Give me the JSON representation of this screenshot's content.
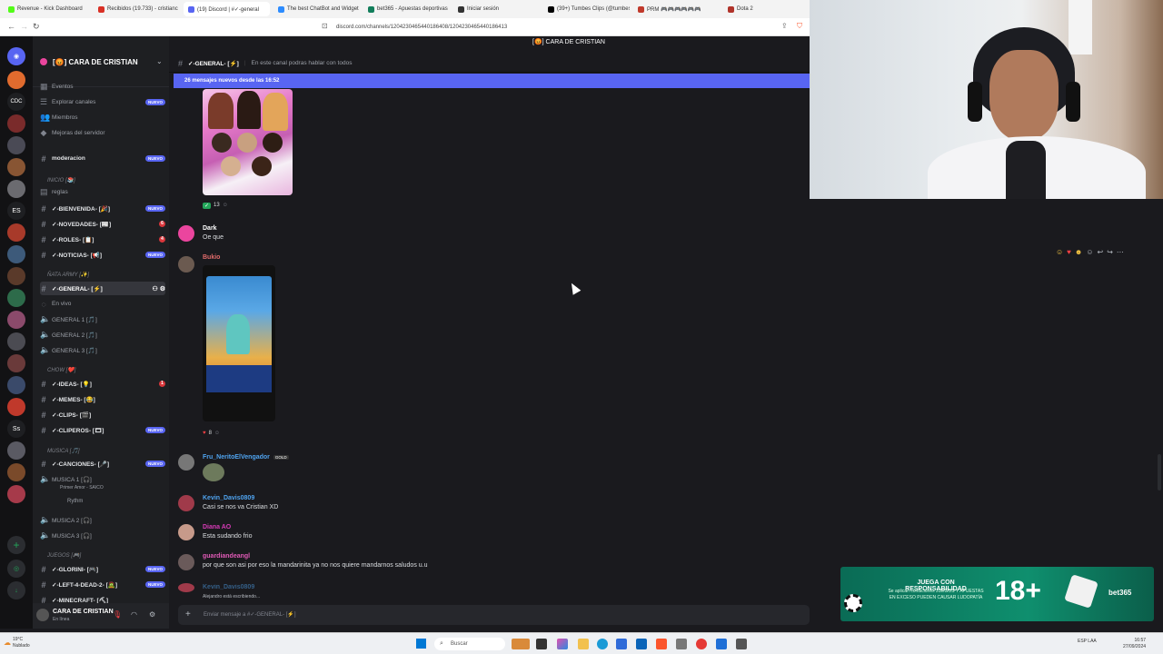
{
  "browser": {
    "tabs": [
      {
        "label": "Revenue - Kick Dashboard",
        "color": "#53fc18"
      },
      {
        "label": "Recibidos (19.733) - cristianc",
        "color": "#d93025"
      },
      {
        "label": "(19) Discord | #✓-general",
        "color": "#5865f2",
        "active": true
      },
      {
        "label": "The best ChatBot and Widget",
        "color": "#2d8cff"
      },
      {
        "label": "bet365 - Apuestas deportivas",
        "color": "#127e5b"
      },
      {
        "label": "Iniciar sesión",
        "color": "#333333"
      },
      {
        "label": "(39+) Tumbes Clips (@tumbes",
        "color": "#000000"
      },
      {
        "label": "PRM 🎮🎮🎮🎮🎮🎮",
        "color": "#c0392b"
      },
      {
        "label": "Dota 2",
        "color": "#b0332a"
      }
    ],
    "url": "discord.com/channels/1204230465440186408/1204230465440186413"
  },
  "server": {
    "name": "[😡] CARA DE CRISTIAN",
    "top_label": "[😡] CARA DE CRISTIAN",
    "menu": [
      "Eventos",
      "Explorar canales",
      "Miembros",
      "Mejoras del servidor"
    ],
    "nuevo": "NUEVO"
  },
  "channels": {
    "moderacion": "moderacion",
    "inicio_cat": "INICIO [📚]",
    "reglas": "reglas",
    "bienvenida": "✓-BIENVENIDA- [🎉]",
    "novedades": "✓-NOVEDADES- [📰]",
    "roles": "✓-ROLES- [📋]",
    "noticias": "✓-NOTICIAS- [📢]",
    "nata_cat": "ÑATA ARMY [✨]",
    "general": "✓-GENERAL- [⚡]",
    "envivo": "En vivo",
    "gen1": "GENERAL 1 [🎵]",
    "gen2": "GENERAL 2 [🎵]",
    "gen3": "GENERAL 3 [🎵]",
    "chow_cat": "CHOW [❤️]",
    "ideas": "✓-IDEAS- [💡]",
    "memes": "✓-MEMES- [😂]",
    "clips": "✓-CLIPS- [🎬]",
    "clipersos": "✓-CLIPEROS- [🎞]",
    "musica_cat": "MUSICA [🎵]",
    "canciones": "✓-CANCIONES- [🎤]",
    "musica1": "MUSICA 1 [🎧]",
    "primer_amor": "Primer Amor - SAICO",
    "rythm": "Rythm",
    "musica2": "MUSICA 2 [🎧]",
    "musica3": "MUSICA 3 [🎧]",
    "juegos_cat": "JUEGOS [🎮]",
    "glorini": "✓-GLORINI- [🎮]",
    "left4dead": "✓-LEFT-4-DEAD-2- [🧟]",
    "minecraft": "✓-MINECRAFT- [⛏]"
  },
  "user": {
    "name": "CARA DE CRISTIAN",
    "status": "En línea"
  },
  "header": {
    "channel": "✓-GENERAL- [⚡]",
    "topic": "En este canal podras hablar con todos"
  },
  "banner": "26 mensajes nuevos desde las 16:52",
  "messages": {
    "m1_reacts": [
      "13"
    ],
    "dark_name": "Dark",
    "dark_text": "Oe que",
    "bukio_name": "Bukio",
    "bukio_reacts": [
      "8"
    ],
    "fru_name": "Fru_NeritoElVengador",
    "fru_badge": "GOLD",
    "kevin_name": "Kevin_Davis0809",
    "kevin_text": "Casi se nos va Cristian XD",
    "diana_name": "Diana AO",
    "diana_text": "Esta sudando frio",
    "guard_name": "guardiandeangl",
    "guard_text": "por que son asi por eso la mandarinita ya no nos quiere mandarnos saludos u.u",
    "kevin2_name": "Kevin_Davis0809",
    "typing": "Alejandro está escribiendo..."
  },
  "composer": {
    "placeholder": "Enviar mensaje a #✓-GENERAL- [⚡]"
  },
  "ad": {
    "title": "JUEGA CON RESPONSABILIDAD",
    "sub": "Se aplican condiciones JUEGOS Y APUESTAS EN EXCESO PUEDEN CAUSAR LUDOPATÍA",
    "age": "18+",
    "brand": "bet365"
  },
  "taskbar": {
    "search": "Buscar",
    "weather_temp": "19°C",
    "weather_desc": "Nublado",
    "lang": "ESP LAA",
    "time": "16:57",
    "date": "27/09/2024"
  }
}
